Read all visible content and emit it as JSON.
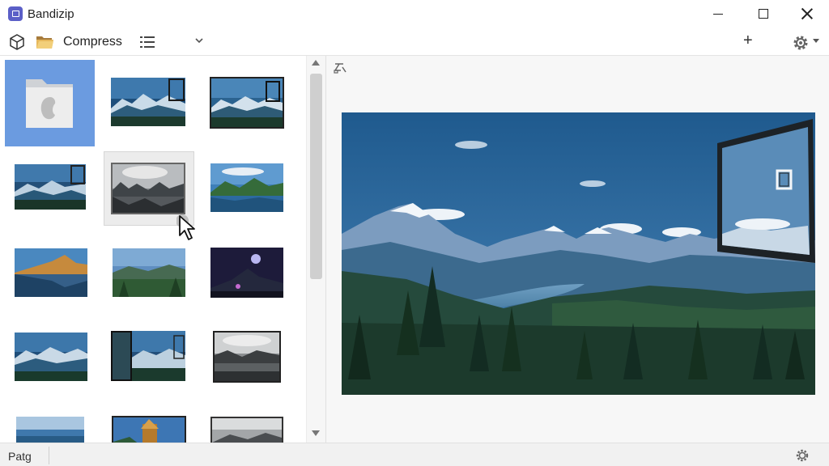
{
  "window": {
    "title": "Bandizip"
  },
  "toolbar": {
    "compress_label": "Compress",
    "add_label": "+"
  },
  "status": {
    "label": "Patg"
  },
  "icons": {
    "app": "bandizip-app-icon",
    "cube": "package-icon",
    "folder": "folder-open-icon",
    "list": "list-view-icon",
    "settings": "gear-icon"
  },
  "colors": {
    "selection": "#6b9be0",
    "app_accent": "#5b5fc7",
    "scrollbar": "#cfcfcf"
  }
}
